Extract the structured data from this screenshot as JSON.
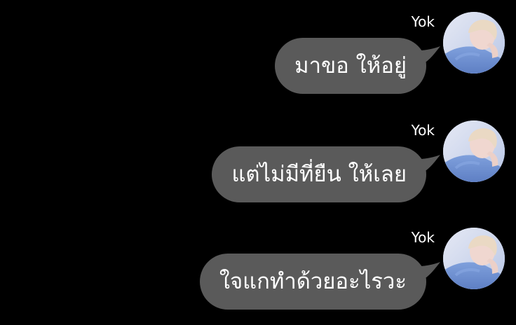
{
  "chat": {
    "messages": [
      {
        "sender": "Yok",
        "text": "มาขอ ให้อยู่",
        "avatar_icon": "profile-photo-icon"
      },
      {
        "sender": "Yok",
        "text": "แต่ไม่มีที่ยืน ให้เลย",
        "avatar_icon": "profile-photo-icon"
      },
      {
        "sender": "Yok",
        "text": "ใจแกทำด้วยอะไรวะ",
        "avatar_icon": "profile-photo-icon"
      }
    ]
  },
  "colors": {
    "background": "#000000",
    "bubble": "#5a5a5a",
    "text": "#ffffff",
    "avatar_shirt": "#6f8fd0"
  }
}
